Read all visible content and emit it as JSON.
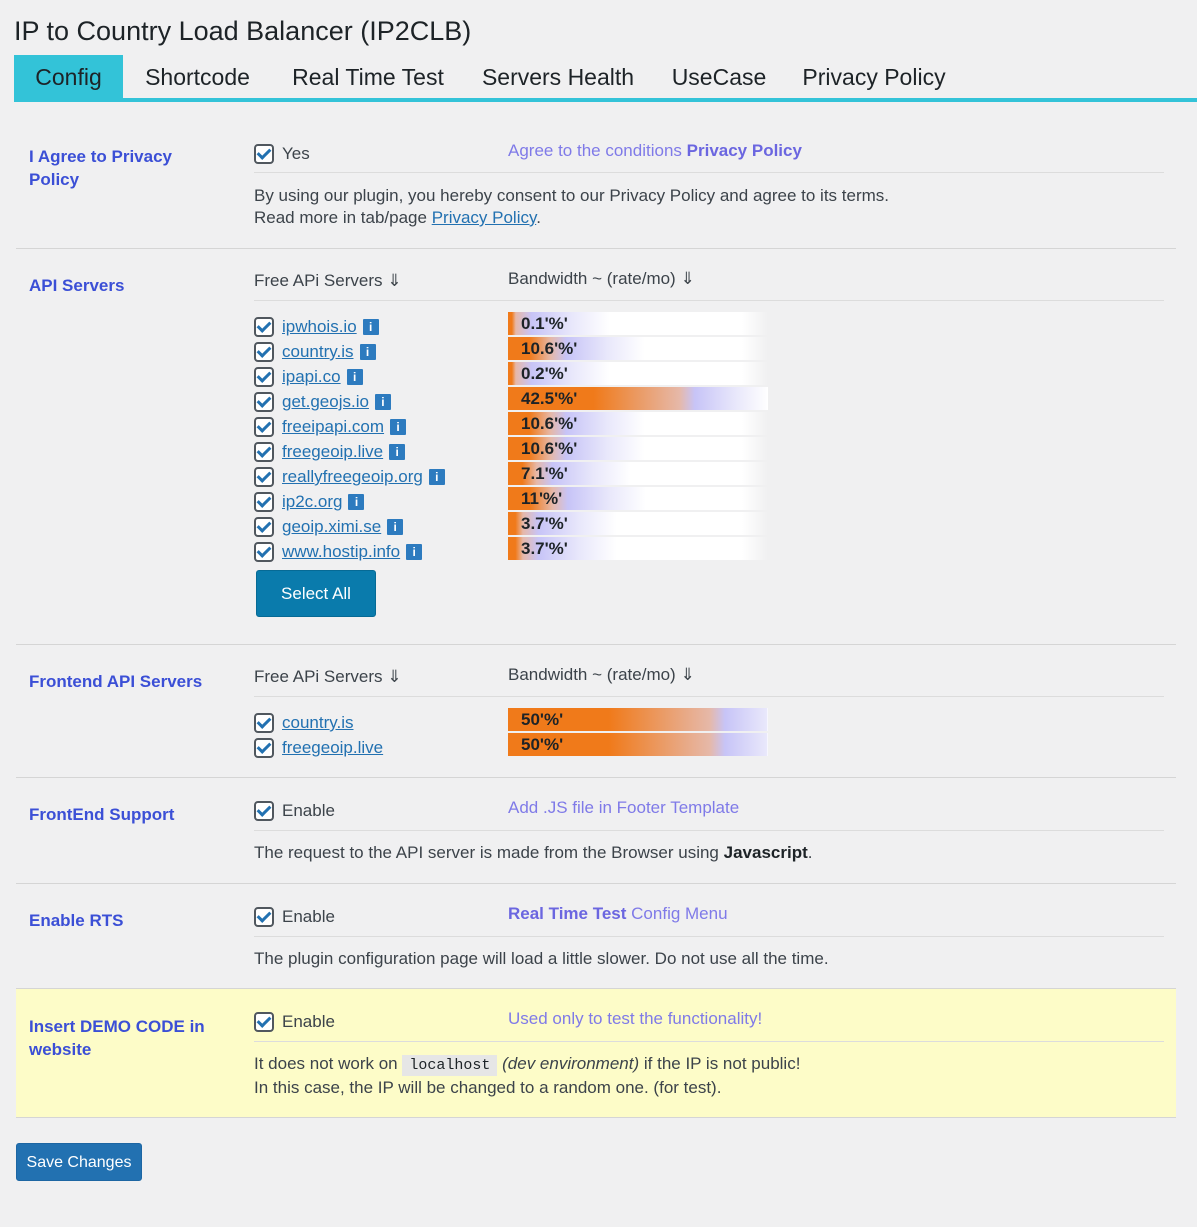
{
  "page": {
    "title": "IP to Country Load Balancer (IP2CLB)"
  },
  "tabs": [
    {
      "label": "Config",
      "active": true
    },
    {
      "label": "Shortcode"
    },
    {
      "label": "Real Time Test"
    },
    {
      "label": "Servers Health"
    },
    {
      "label": "UseCase"
    },
    {
      "label": "Privacy Policy"
    }
  ],
  "privacy": {
    "label": "I Agree to Privacy Policy",
    "checkbox_label": "Yes",
    "hint_prefix": "Agree to the conditions",
    "hint_link": "Privacy Policy",
    "desc_line1": "By using our plugin, you hereby consent to our Privacy Policy and agree to its terms.",
    "desc_line2_prefix": "Read more in tab/page",
    "desc_line2_link": "Privacy Policy",
    "desc_line2_suffix": "."
  },
  "api_servers": {
    "label": "API Servers",
    "col_servers": "Free APi Servers ⇓",
    "col_bandwidth": "Bandwidth ~ (rate/mo) ⇓",
    "info_glyph": "i",
    "servers": [
      {
        "name": "ipwhois.io",
        "bandwidth": "0.1'%'",
        "percent": 0.1
      },
      {
        "name": "country.is",
        "bandwidth": "10.6'%'",
        "percent": 10.6
      },
      {
        "name": "ipapi.co",
        "bandwidth": "0.2'%'",
        "percent": 0.2
      },
      {
        "name": "get.geojs.io",
        "bandwidth": "42.5'%'",
        "percent": 42.5
      },
      {
        "name": "freeipapi.com",
        "bandwidth": "10.6'%'",
        "percent": 10.6
      },
      {
        "name": "freegeoip.live",
        "bandwidth": "10.6'%'",
        "percent": 10.6
      },
      {
        "name": "reallyfreegeoip.org",
        "bandwidth": "7.1'%'",
        "percent": 7.1
      },
      {
        "name": "ip2c.org",
        "bandwidth": "11'%'",
        "percent": 11
      },
      {
        "name": "geoip.ximi.se",
        "bandwidth": "3.7'%'",
        "percent": 3.7
      },
      {
        "name": "www.hostip.info",
        "bandwidth": "3.7'%'",
        "percent": 3.7
      }
    ],
    "select_all": "Select All"
  },
  "frontend_servers": {
    "label": "Frontend API Servers",
    "col_servers": "Free APi Servers ⇓",
    "col_bandwidth": "Bandwidth ~ (rate/mo) ⇓",
    "servers": [
      {
        "name": "country.is",
        "bandwidth": "50'%'",
        "percent": 50
      },
      {
        "name": "freegeoip.live",
        "bandwidth": "50'%'",
        "percent": 50
      }
    ]
  },
  "frontend_support": {
    "label": "FrontEnd Support",
    "checkbox_label": "Enable",
    "hint": "Add .JS file in Footer Template",
    "desc_prefix": "The request to the API server is made from the Browser using",
    "desc_bold": "Javascript",
    "desc_suffix": "."
  },
  "rts": {
    "label": "Enable RTS",
    "checkbox_label": "Enable",
    "hint_bold": "Real Time Test",
    "hint_rest": "Config Menu",
    "desc": "The plugin configuration page will load a little slower. Do not use all the time."
  },
  "demo": {
    "label": "Insert DEMO CODE in website",
    "checkbox_label": "Enable",
    "hint": "Used only to test the functionality!",
    "desc_prefix": "It does not work on",
    "desc_code": "localhost",
    "desc_italic": "(dev environment)",
    "desc_suffix": "if the IP is not public!",
    "desc_line2": "In this case, the IP will be changed to a random one. (for test)."
  },
  "footer": {
    "save_label": "Save Changes"
  },
  "colors": {
    "accent": "#33c3d8",
    "link": "#2271b1",
    "label_blue": "#3b4fd6",
    "hint_purple": "#7f7ae8",
    "button": "#0a7bac",
    "bar_orange": "#f07a1a",
    "bar_lavender": "#c7c4f7",
    "demo_bg": "#fdfcc8"
  }
}
